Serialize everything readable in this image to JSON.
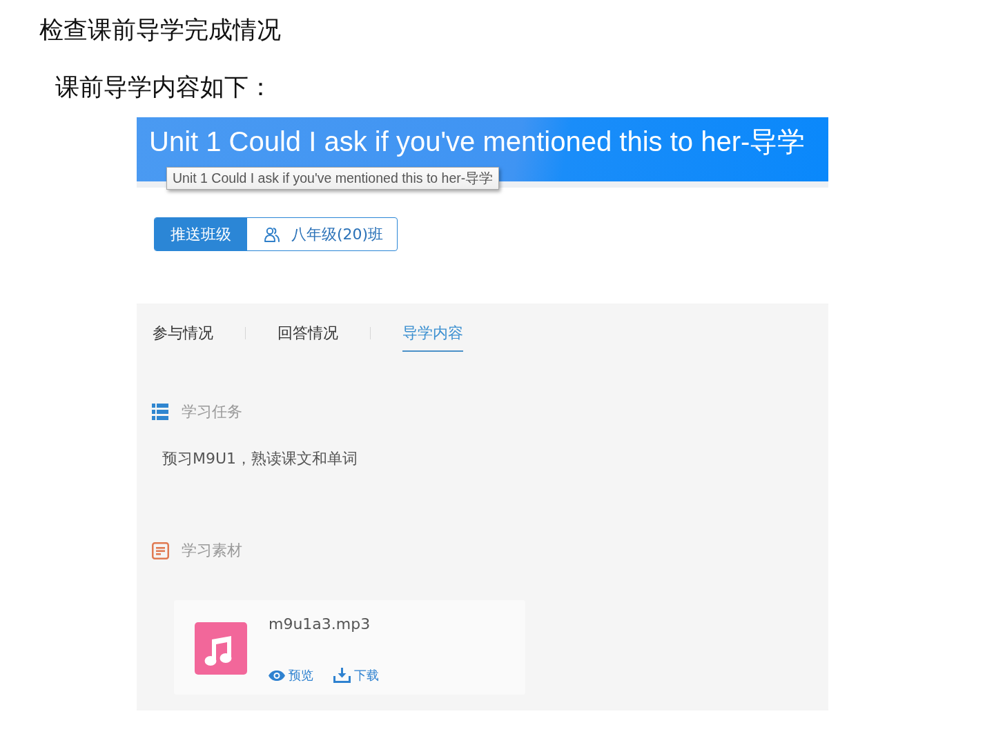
{
  "document": {
    "heading": "检查课前导学完成情况",
    "intro": "课前导学内容如下："
  },
  "screenshot": {
    "banner": {
      "title": "Unit 1 Could I ask if you've mentioned this to her-导学",
      "tooltip": "Unit 1 Could I ask if you've mentioned this to her-导学"
    },
    "push_class": {
      "label": "推送班级",
      "class_name": "八年级(20)班"
    },
    "tabs": [
      {
        "label": "参与情况",
        "selected": false
      },
      {
        "label": "回答情况",
        "selected": false
      },
      {
        "label": "导学内容",
        "selected": true
      }
    ],
    "sections": [
      {
        "kind": "task",
        "title": "学习任务",
        "text": "预习M9U1，熟读课文和单词"
      },
      {
        "kind": "material",
        "title": "学习素材",
        "files": [
          {
            "name": "m9u1a3.mp3",
            "actions": [
              {
                "kind": "preview",
                "label": "预览"
              },
              {
                "kind": "download",
                "label": "下载"
              }
            ]
          }
        ]
      }
    ]
  }
}
